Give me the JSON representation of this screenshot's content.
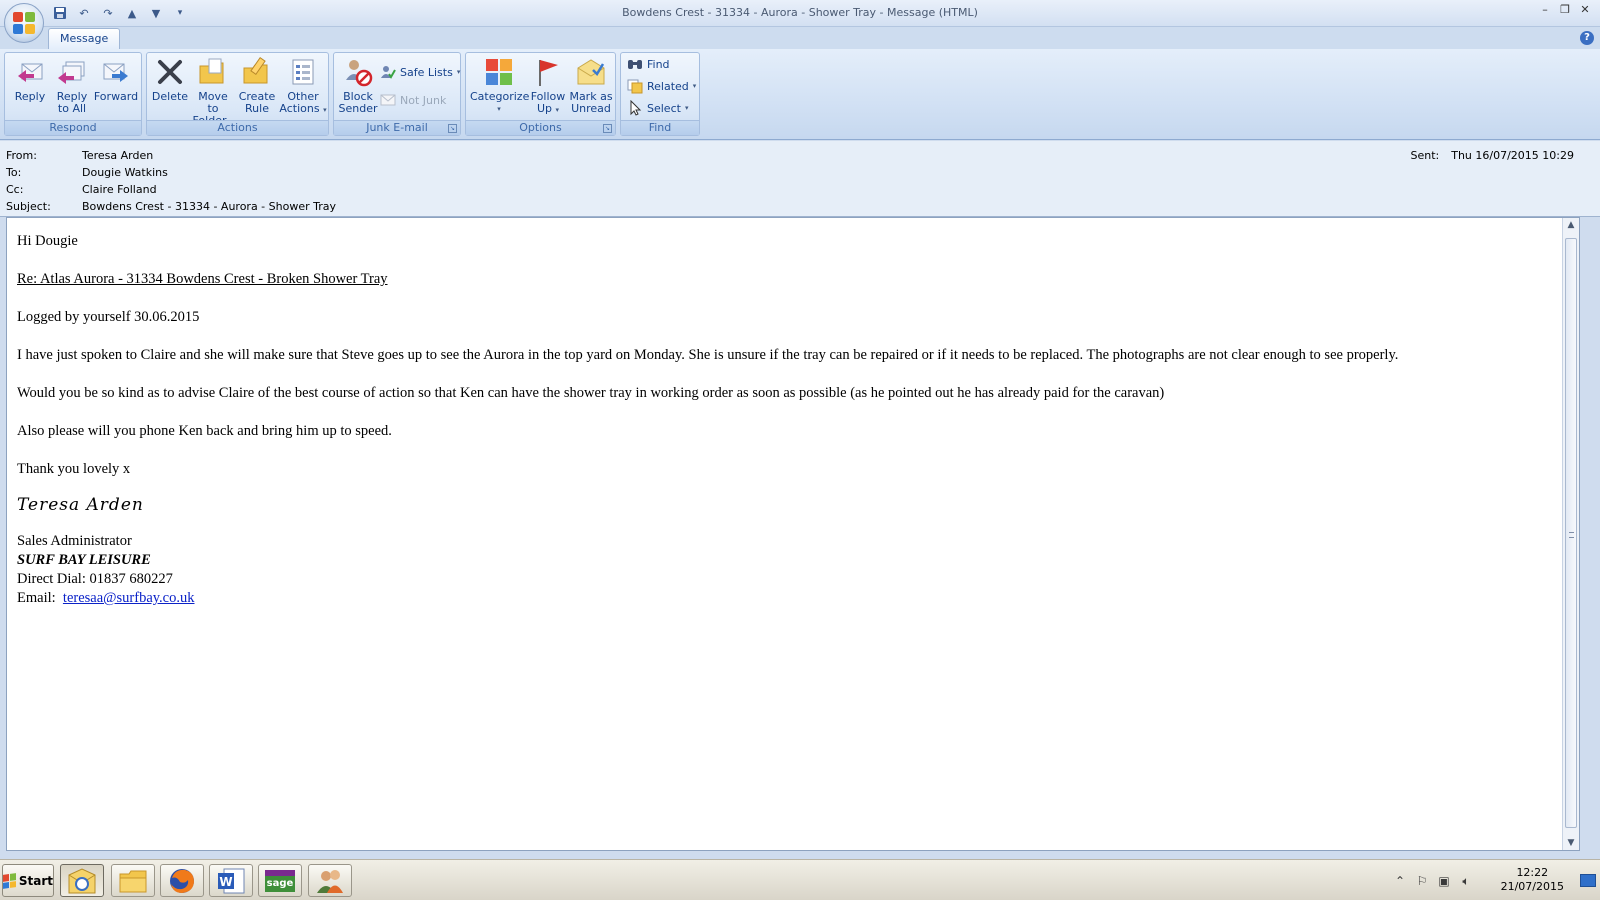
{
  "window": {
    "title": "Bowdens Crest - 31334 - Aurora - Shower Tray - Message (HTML)",
    "tabs": [
      "Message"
    ]
  },
  "ribbon": {
    "groups": {
      "respond": "Respond",
      "actions": "Actions",
      "junk": "Junk E-mail",
      "options": "Options",
      "find": "Find"
    },
    "reply": "Reply",
    "reply_all_1": "Reply",
    "reply_all_2": "to All",
    "forward": "Forward",
    "delete": "Delete",
    "move_1": "Move to",
    "move_2": "Folder",
    "create_rule_1": "Create",
    "create_rule_2": "Rule",
    "other_actions_1": "Other",
    "other_actions_2": "Actions",
    "block_1": "Block",
    "block_2": "Sender",
    "safe_lists": "Safe Lists",
    "not_junk": "Not Junk",
    "categorize": "Categorize",
    "follow_up_1": "Follow",
    "follow_up_2": "Up",
    "mark_unread_1": "Mark as",
    "mark_unread_2": "Unread",
    "find_btn": "Find",
    "related": "Related",
    "select": "Select"
  },
  "header": {
    "from_label": "From:",
    "from": "Teresa Arden",
    "to_label": "To:",
    "to": "Dougie Watkins",
    "cc_label": "Cc:",
    "cc": "Claire Folland",
    "subject_label": "Subject:",
    "subject": "Bowdens Crest - 31334 - Aurora - Shower Tray",
    "sent_label": "Sent:",
    "sent": "Thu 16/07/2015 10:29"
  },
  "body": {
    "greeting": "Hi Dougie",
    "re_line": "Re: Atlas Aurora - 31334 Bowdens Crest - Broken Shower Tray",
    "logged": "Logged by yourself 30.06.2015",
    "para1": "I have just spoken to Claire and she will make sure that Steve goes up to see the Aurora in the top yard on Monday.   She is unsure if the tray can be repaired or if it needs to be replaced.  The photographs are not clear enough to see properly.",
    "para2": "Would you be so kind as to advise Claire of the best course of action so that Ken can have the shower tray in working order as soon as possible (as he pointed out he has already paid for the caravan)",
    "para3": "Also please will you phone Ken back and bring him up to speed.",
    "thanks": "Thank you lovely x",
    "signature_name": "Teresa Arden",
    "sig_title": "Sales Administrator",
    "sig_company": "SURF BAY LEISURE",
    "sig_phone": "Direct Dial:  01837 680227",
    "sig_email_label": "Email:",
    "sig_email": "teresaa@surfbay.co.uk"
  },
  "taskbar": {
    "start": "Start",
    "time": "12:22",
    "date": "21/07/2015"
  },
  "colors": {
    "ribbon_label": "#3e6aaa",
    "link": "#0b22c8"
  }
}
